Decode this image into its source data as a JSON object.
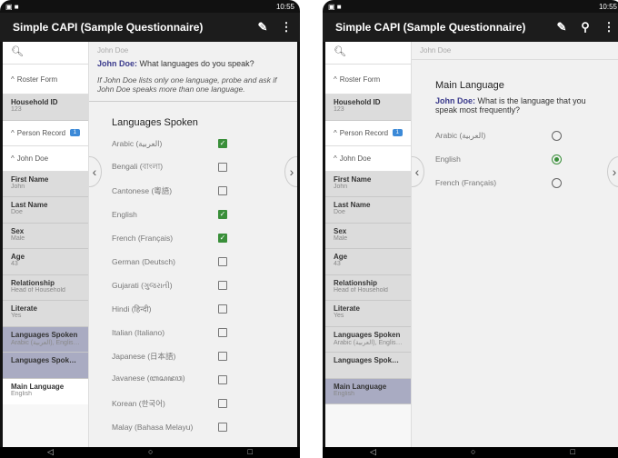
{
  "app_title": "Simple CAPI (Sample Questionnaire)",
  "status_time": "10:55",
  "left": {
    "breadcrumb": "John Doe",
    "question_name": "John Doe:",
    "question_text": " What languages do you speak?",
    "help_text": "If John Doe lists only one language, probe and ask if John Doe speaks more than one language.",
    "section_title": "Languages Spoken",
    "options": [
      {
        "label": "Arabic (العربية)",
        "checked": true
      },
      {
        "label": "Bengali (বাংলা)",
        "checked": false
      },
      {
        "label": "Cantonese (粵語)",
        "checked": false
      },
      {
        "label": "English",
        "checked": true
      },
      {
        "label": "French (Français)",
        "checked": true
      },
      {
        "label": "German (Deutsch)",
        "checked": false
      },
      {
        "label": "Gujarati (ગુજરાતી)",
        "checked": false
      },
      {
        "label": "Hindi (हिन्दी)",
        "checked": false
      },
      {
        "label": "Italian (Italiano)",
        "checked": false
      },
      {
        "label": "Japanese (日本語)",
        "checked": false
      },
      {
        "label": "Javanese (ꦧꦱꦗꦮ)",
        "checked": false
      },
      {
        "label": "Korean (한국어)",
        "checked": false
      },
      {
        "label": "Malay (Bahasa Melayu)",
        "checked": false
      }
    ]
  },
  "right": {
    "breadcrumb": "John Doe",
    "section_title": "Main Language",
    "question_name": "John Doe:",
    "question_text": " What is the language that you speak most frequently?",
    "options": [
      {
        "label": "Arabic (العربية)",
        "selected": false
      },
      {
        "label": "English",
        "selected": true
      },
      {
        "label": "French (Français)",
        "selected": false
      }
    ]
  },
  "sidebar": {
    "groups": {
      "roster": "Roster Form",
      "person": "Person Record",
      "person_badge": "1",
      "john": "John Doe"
    },
    "fields": [
      {
        "label": "First Name",
        "value": "John"
      },
      {
        "label": "Last Name",
        "value": "Doe"
      },
      {
        "label": "Sex",
        "value": "Male"
      },
      {
        "label": "Age",
        "value": "43"
      },
      {
        "label": "Relationship",
        "value": "Head of Household"
      },
      {
        "label": "Literate",
        "value": "Yes"
      },
      {
        "label": "Languages Spoken",
        "value": "Arabic (العربية), English, ..."
      },
      {
        "label": "Languages Spoken (...",
        "value": ""
      },
      {
        "label": "Main Language",
        "value": "English"
      }
    ],
    "household": {
      "label": "Household ID",
      "value": "123"
    }
  }
}
